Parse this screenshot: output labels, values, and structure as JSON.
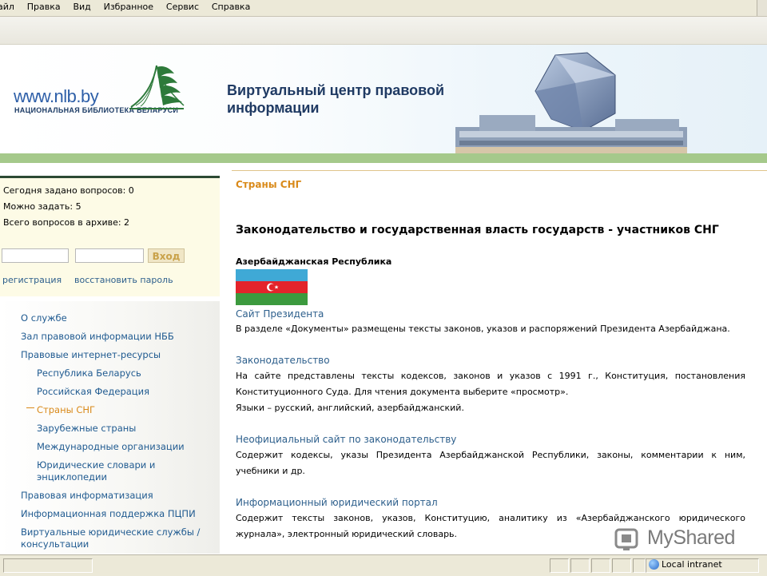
{
  "menu": [
    "айл",
    "Правка",
    "Вид",
    "Избранное",
    "Сервис",
    "Справка"
  ],
  "header": {
    "logo_url": "www.nlb.by",
    "logo_sub": "НАЦИОНАЛЬНАЯ БИБЛИОТЕКА БЕЛАРУСИ",
    "title_line1": "Виртуальный центр правовой",
    "title_line2": "информации"
  },
  "sidebar": {
    "stats": [
      "Сегодня задано вопросов: 0",
      "Можно задать: 5",
      "Всего вопросов в архиве: 2"
    ],
    "login_button": "Вход",
    "register_link": "регистрация",
    "restore_link": "восстановить пароль",
    "nav": [
      {
        "label": "О службе"
      },
      {
        "label": "Зал правовой информации НББ"
      },
      {
        "label": "Правовые интернет-ресурсы"
      },
      {
        "label": "Республика Беларусь"
      },
      {
        "label": "Российская Федерация"
      },
      {
        "label": "Страны СНГ"
      },
      {
        "label": "Зарубежные страны"
      },
      {
        "label": "Международные организации"
      },
      {
        "label": "Юридические словари и"
      },
      {
        "label": "энциклопедии"
      },
      {
        "label": "Правовая информатизация"
      },
      {
        "label": "Информационная поддержка ПЦПИ"
      },
      {
        "label": "Виртуальные юридические службы /"
      },
      {
        "label": "консультации"
      }
    ]
  },
  "content": {
    "breadcrumb": "Страны СНГ",
    "title": "Законодательство и государственная власть государств - участников СНГ",
    "country": "Азербайджанская Республика",
    "flag_colors": [
      "#3fa9d6",
      "#e3242b",
      "#3c9a3e"
    ],
    "resources": [
      {
        "link": "Сайт Президента",
        "lines": [
          "В разделе «Документы» размещены тексты законов, указов и распоряжений Президента Азербайджана."
        ]
      },
      {
        "link": "Законодательство",
        "lines": [
          "На сайте представлены тексты кодексов, законов и указов с 1991 г., Конституция, постановления Конституционного Суда. Для чтения документа выберите «просмотр».",
          "Языки – русский, английский, азербайджанский."
        ]
      },
      {
        "link": "Неофициальный сайт по законодательству",
        "lines": [
          "Содержит кодексы, указы Президента Азербайджанской Республики, законы, комментарии к ним, учебники и др."
        ]
      },
      {
        "link": "Информационный юридический портал",
        "lines": [
          "Содержит тексты законов, указов, Конституцию, аналитику из «Азербайджанского юридического журнала», электронный юридический словарь."
        ]
      }
    ]
  },
  "statusbar": {
    "zone": "Local intranet"
  },
  "watermark": {
    "text": "MyShared"
  },
  "colors": {
    "accent_orange": "#d98a1a",
    "link_blue": "#2d5f8c",
    "green_bar": "#a5c98b",
    "title_navy": "#1f3a63"
  }
}
